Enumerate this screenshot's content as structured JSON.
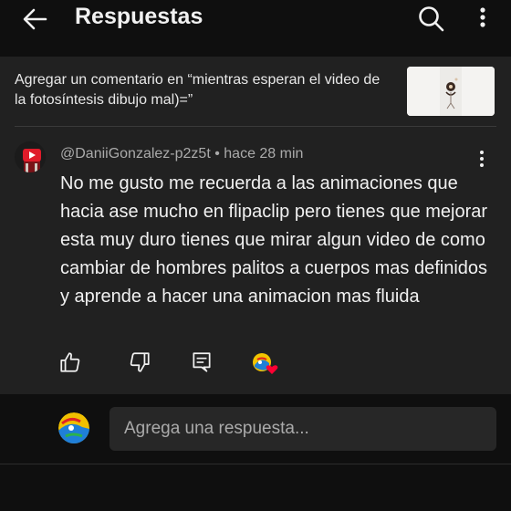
{
  "header": {
    "title": "Respuestas",
    "back_icon": "arrow-left-icon",
    "search_icon": "search-icon",
    "more_icon": "more-vert-icon"
  },
  "context": {
    "text": "Agregar un comentario en “mientras esperan el video de la fotosíntesis dibujo mal)=”"
  },
  "comment": {
    "author": "@DaniiGonzalez-p2z5t",
    "separator": " • ",
    "time": "hace 28 min",
    "body": "No me gusto me recuerda a las animaciones que hacia ase mucho en flipaclip pero tienes que mejorar esta muy duro tienes que mirar algun video de como cambiar de hombres palitos a cuerpos mas definidos y aprende a hacer una animacion mas fluida",
    "actions": [
      "like-icon",
      "dislike-icon",
      "reply-icon",
      "creator-heart-icon"
    ]
  },
  "reply_box": {
    "placeholder": "Agrega una respuesta..."
  },
  "colors": {
    "background": "#0f0f0f",
    "panel": "#212121",
    "input": "#272727",
    "heart": "#ff0033"
  }
}
